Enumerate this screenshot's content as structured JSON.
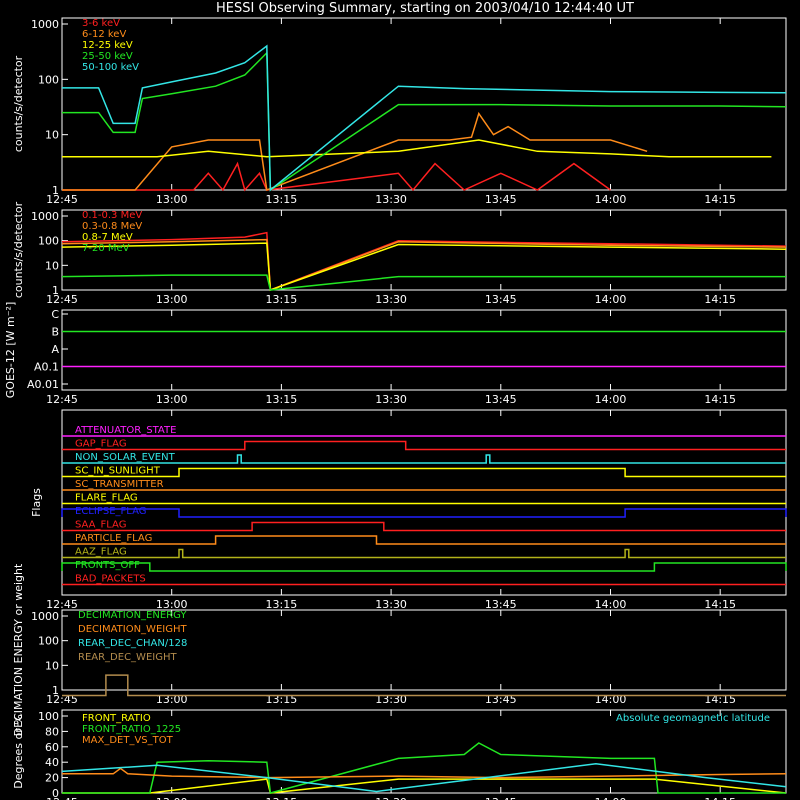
{
  "title": "HESSI Observing Summary, starting on 2003/04/10 12:44:40 UT",
  "time_ticks": [
    "12:45",
    "13:00",
    "13:15",
    "13:30",
    "13:45",
    "14:00",
    "14:15"
  ],
  "colors": {
    "background": "#000000",
    "axes": "#ffffff",
    "red": "#ff2020",
    "orange": "#ff8c1a",
    "yellow": "#ffff00",
    "green": "#22e622",
    "cyan": "#33e6e6",
    "magenta": "#ff20ff",
    "blue": "#2020ff",
    "olive": "#b3b31a",
    "tan": "#b38c4d"
  },
  "chart_data": [
    {
      "type": "line",
      "panel": "low-energy-rates",
      "ylabel": "counts/s/detector",
      "yscale": "log",
      "ylim": [
        1,
        1000
      ],
      "ytick_labels": [
        "1",
        "10",
        "100",
        "1000"
      ],
      "legend_position": "top-left",
      "series": [
        {
          "name": "3-6 keV",
          "color": "red",
          "x": [
            "12:45",
            "12:55",
            "13:03",
            "13:05",
            "13:07",
            "13:09",
            "13:10",
            "13:12",
            "13:13",
            "13:31",
            "13:33",
            "13:36",
            "13:40",
            "13:45",
            "13:50",
            "13:55",
            "14:00"
          ],
          "values": [
            1,
            1,
            1,
            2,
            1,
            3,
            1,
            2,
            1,
            2,
            1,
            3,
            1,
            2,
            1,
            3,
            1
          ]
        },
        {
          "name": "6-12 keV",
          "color": "orange",
          "x": [
            "12:45",
            "12:55",
            "13:00",
            "13:05",
            "13:12",
            "13:13",
            "13:31",
            "13:38",
            "13:41",
            "13:42",
            "13:44",
            "13:46",
            "13:49",
            "13:55",
            "14:00",
            "14:05"
          ],
          "values": [
            1,
            1,
            6,
            8,
            8,
            1,
            8,
            8,
            9,
            24,
            10,
            14,
            8,
            8,
            8,
            5
          ]
        },
        {
          "name": "12-25 keV",
          "color": "yellow",
          "x": [
            "12:45",
            "12:55",
            "12:58",
            "13:05",
            "13:13",
            "13:31",
            "13:42",
            "13:50",
            "14:00",
            "14:08",
            "14:15",
            "14:22"
          ],
          "values": [
            4,
            4,
            4,
            5,
            4,
            5,
            8,
            5,
            4.5,
            4,
            4,
            4
          ]
        },
        {
          "name": "25-50 keV",
          "color": "green",
          "x": [
            "12:45",
            "12:50",
            "12:52",
            "12:55",
            "12:56",
            "13:00",
            "13:06",
            "13:10",
            "13:13",
            "13:13.5",
            "13:31",
            "13:45",
            "14:00",
            "14:15",
            "14:24"
          ],
          "values": [
            25,
            25,
            11,
            11,
            45,
            55,
            75,
            120,
            300,
            1,
            35,
            35,
            33,
            33,
            32
          ]
        },
        {
          "name": "50-100 keV",
          "color": "cyan",
          "x": [
            "12:45",
            "12:50",
            "12:52",
            "12:55",
            "12:56",
            "13:00",
            "13:06",
            "13:10",
            "13:13",
            "13:13.5",
            "13:31",
            "13:40",
            "13:50",
            "14:00",
            "14:15",
            "14:24"
          ],
          "values": [
            70,
            70,
            16,
            16,
            70,
            90,
            130,
            200,
            400,
            1,
            75,
            68,
            64,
            60,
            58,
            57
          ]
        }
      ]
    },
    {
      "type": "line",
      "panel": "high-energy-rates",
      "ylabel": "counts/s/detector",
      "yscale": "log",
      "ylim": [
        1,
        1000
      ],
      "ytick_labels": [
        "1",
        "10",
        "100",
        "1000"
      ],
      "legend_position": "top-left",
      "series": [
        {
          "name": "0.1-0.3 MeV",
          "color": "red",
          "x": [
            "12:45",
            "13:00",
            "13:10",
            "13:13",
            "13:13.5",
            "13:31",
            "13:45",
            "14:00",
            "14:15",
            "14:24"
          ],
          "values": [
            90,
            110,
            140,
            210,
            1,
            100,
            85,
            75,
            65,
            60
          ]
        },
        {
          "name": "0.3-0.8 MeV",
          "color": "orange",
          "x": [
            "12:45",
            "13:00",
            "13:13",
            "13:13.5",
            "13:31",
            "14:00",
            "14:24"
          ],
          "values": [
            75,
            90,
            110,
            1,
            90,
            65,
            55
          ]
        },
        {
          "name": "0.8-7 MeV",
          "color": "yellow",
          "x": [
            "12:45",
            "13:00",
            "13:13",
            "13:13.5",
            "13:31",
            "14:00",
            "14:24"
          ],
          "values": [
            55,
            65,
            80,
            1,
            70,
            55,
            45
          ]
        },
        {
          "name": "7-20 MeV",
          "color": "green",
          "x": [
            "12:45",
            "13:00",
            "13:13",
            "13:13.5",
            "13:31",
            "14:00",
            "14:24"
          ],
          "values": [
            3.5,
            4,
            4,
            1,
            3.5,
            3.5,
            3.5
          ]
        }
      ]
    },
    {
      "type": "line",
      "panel": "goes",
      "ylabel": "GOES-12 [W m⁻²]",
      "ytick_labels": [
        "A0.01",
        "A0.1",
        "A",
        "B",
        "C"
      ],
      "ylim": [
        "A0.01",
        "C"
      ],
      "series": [
        {
          "color": "green",
          "x": [
            "12:45",
            "13:00",
            "13:15",
            "13:30",
            "13:42",
            "13:45",
            "14:00",
            "14:24"
          ],
          "values": [
            "B",
            "B",
            "B",
            "B",
            "B",
            "B",
            "B",
            "B"
          ]
        },
        {
          "color": "magenta",
          "x": [
            "12:45",
            "13:00",
            "13:15",
            "13:30",
            "13:45",
            "14:00",
            "14:24"
          ],
          "values": [
            "A0.1",
            "A0.1",
            "A0.1",
            "A0.1",
            "A0.1",
            "A0.1",
            "A0.1"
          ]
        }
      ]
    },
    {
      "type": "line",
      "panel": "flags",
      "ylabel": "Flags",
      "series": [
        {
          "name": "ATTENUATOR_STATE",
          "color": "magenta",
          "on_intervals": []
        },
        {
          "name": "GAP_FLAG",
          "color": "red",
          "on_intervals": [
            [
              "13:10",
              "13:32"
            ]
          ]
        },
        {
          "name": "NON_SOLAR_EVENT",
          "color": "cyan",
          "on_intervals": [
            [
              "13:09",
              "13:09.5"
            ],
            [
              "13:43",
              "13:43.5"
            ]
          ]
        },
        {
          "name": "SC_IN_SUNLIGHT",
          "color": "yellow",
          "on_intervals": [
            [
              "13:01",
              "14:02"
            ]
          ]
        },
        {
          "name": "SC_TRANSMITTER",
          "color": "orange",
          "on_intervals": []
        },
        {
          "name": "FLARE_FLAG",
          "color": "yellow",
          "on_intervals": []
        },
        {
          "name": "ECLIPSE_FLAG",
          "color": "blue",
          "on_intervals": [
            [
              "12:45",
              "13:01"
            ],
            [
              "14:02",
              "14:24"
            ]
          ]
        },
        {
          "name": "SAA_FLAG",
          "color": "red",
          "on_intervals": [
            [
              "13:11",
              "13:29"
            ]
          ]
        },
        {
          "name": "PARTICLE_FLAG",
          "color": "orange",
          "on_intervals": [
            [
              "13:06",
              "13:28"
            ]
          ]
        },
        {
          "name": "AAZ_FLAG",
          "color": "olive",
          "on_intervals": [
            [
              "13:01",
              "13:01.5"
            ],
            [
              "14:02",
              "14:02.5"
            ]
          ]
        },
        {
          "name": "FRONTS_OFF",
          "color": "green",
          "on_intervals": [
            [
              "12:45",
              "12:57"
            ],
            [
              "14:06",
              "14:24"
            ]
          ]
        },
        {
          "name": "BAD_PACKETS",
          "color": "red",
          "on_intervals": []
        }
      ]
    },
    {
      "type": "line",
      "panel": "decimation",
      "ylabel": "DECIMATION ENERGY or weight",
      "yscale": "log",
      "ylim": [
        1,
        1000
      ],
      "ytick_labels": [
        "1",
        "10",
        "100",
        "1000"
      ],
      "legend_position": "top-left",
      "series": [
        {
          "name": "DECIMATION_ENERGY",
          "color": "green",
          "x": [],
          "values": []
        },
        {
          "name": "DECIMATION_WEIGHT",
          "color": "orange",
          "x": [],
          "values": []
        },
        {
          "name": "REAR_DEC_CHAN/128",
          "color": "cyan",
          "x": [],
          "values": []
        },
        {
          "name": "REAR_DEC_WEIGHT",
          "color": "tan",
          "x": [
            "12:45",
            "12:51",
            "12:51",
            "12:54",
            "12:54",
            "14:24"
          ],
          "values": [
            0.6,
            0.6,
            4,
            4,
            0.6,
            0.6
          ]
        }
      ]
    },
    {
      "type": "line",
      "panel": "ratios",
      "ylabel": "Degrees or %",
      "ylim": [
        0,
        100
      ],
      "ytick_labels": [
        "0",
        "20",
        "40",
        "60",
        "80",
        "100"
      ],
      "legend_position": "top-left",
      "series": [
        {
          "name": "FRONT_RATIO",
          "color": "yellow",
          "x": [
            "12:45",
            "12:57",
            "13:13",
            "13:13.5",
            "13:31",
            "14:06",
            "14:24"
          ],
          "values": [
            0,
            0,
            18,
            0,
            18,
            18,
            0
          ]
        },
        {
          "name": "FRONT_RATIO_1225",
          "color": "green",
          "x": [
            "12:45",
            "12:57",
            "12:58",
            "13:05",
            "13:13",
            "13:13.5",
            "13:31",
            "13:40",
            "13:42",
            "13:45",
            "14:00",
            "14:06",
            "14:06.5",
            "14:24"
          ],
          "values": [
            0,
            0,
            40,
            42,
            40,
            0,
            45,
            50,
            65,
            50,
            45,
            45,
            0,
            0
          ]
        },
        {
          "name": "MAX_DET_VS_TOT",
          "color": "orange",
          "x": [
            "12:45",
            "12:52",
            "12:53",
            "12:54",
            "13:00",
            "13:13",
            "13:31",
            "13:45",
            "14:00",
            "14:15",
            "14:24"
          ],
          "values": [
            25,
            25,
            32,
            25,
            22,
            20,
            22,
            20,
            22,
            24,
            25
          ]
        },
        {
          "name": "Absolute geomagnetic latitude",
          "color": "cyan",
          "x": [
            "12:45",
            "12:58",
            "13:13",
            "13:28",
            "13:43",
            "13:58",
            "14:13",
            "14:24"
          ],
          "values": [
            28,
            36,
            20,
            2,
            20,
            38,
            20,
            8
          ]
        }
      ]
    }
  ]
}
